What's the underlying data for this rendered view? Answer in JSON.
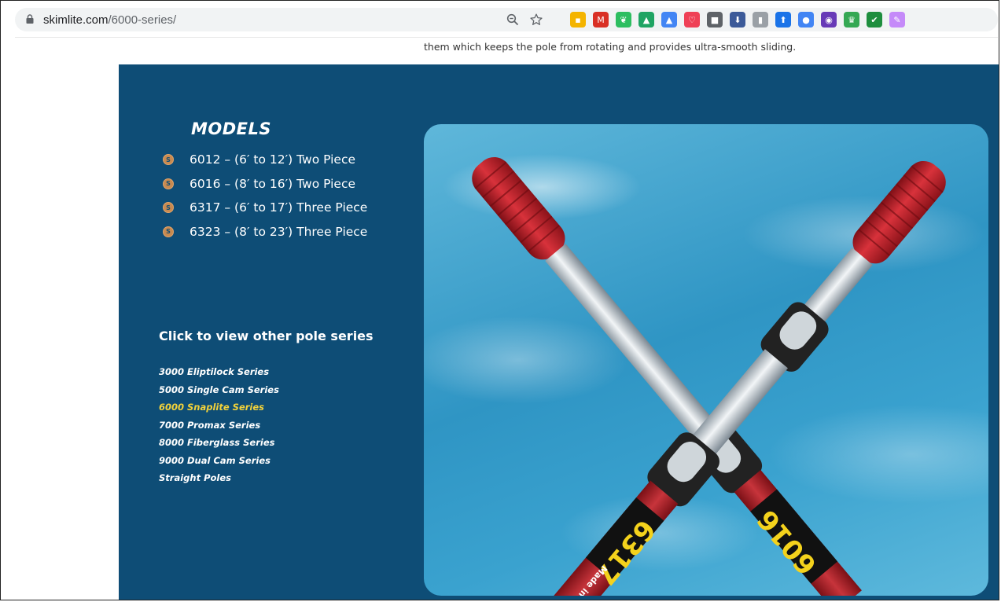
{
  "browser": {
    "url_domain": "skimlite.com",
    "url_path": "/6000-series/",
    "icons": [
      "zoom-icon",
      "bookmark-star-icon"
    ],
    "extensions": [
      {
        "name": "extension-yellow-icon",
        "color": "#f4b400",
        "glyph": "▪"
      },
      {
        "name": "gmail-icon",
        "color": "#d93025",
        "glyph": "M"
      },
      {
        "name": "evernote-icon",
        "color": "#2dbe60",
        "glyph": "❦"
      },
      {
        "name": "google-drive-icon",
        "color": "#1fa463",
        "glyph": "▲"
      },
      {
        "name": "google-drive-alt-icon",
        "color": "#4285f4",
        "glyph": "▲"
      },
      {
        "name": "pocket-icon",
        "color": "#ef4056",
        "glyph": "♡"
      },
      {
        "name": "extension-gray-icon",
        "color": "#5f6368",
        "glyph": "■"
      },
      {
        "name": "download-icon",
        "color": "#3c5a99",
        "glyph": "⬇"
      },
      {
        "name": "office-icon",
        "color": "#9aa0a6",
        "glyph": "▮"
      },
      {
        "name": "upload-icon",
        "color": "#1a73e8",
        "glyph": "⬆"
      },
      {
        "name": "extension-blue-icon",
        "color": "#4285f4",
        "glyph": "●"
      },
      {
        "name": "camera-icon",
        "color": "#673ab7",
        "glyph": "◉"
      },
      {
        "name": "extension-green-icon",
        "color": "#34a853",
        "glyph": "♛"
      },
      {
        "name": "check-icon",
        "color": "#1e8e3e",
        "glyph": "✔"
      },
      {
        "name": "extension-partial-icon",
        "color": "#c58af9",
        "glyph": "✎"
      }
    ]
  },
  "page": {
    "top_text": "them which keeps the pole from rotating and provides ultra-smooth sliding.",
    "models_heading": "MODELS",
    "models": [
      "6012 – (6′ to 12′) Two Piece",
      "6016 – (8′ to 16′) Two Piece",
      "6317 – (6′ to 17′) Three Piece",
      "6323 – (8′ to 23′) Three Piece"
    ],
    "series_heading": "Click to view other pole series",
    "series": [
      {
        "label": "3000 Eliptilock Series",
        "active": false
      },
      {
        "label": "5000 Single Cam Series",
        "active": false
      },
      {
        "label": "6000 Snaplite Series",
        "active": true
      },
      {
        "label": "7000 Promax Series",
        "active": false
      },
      {
        "label": "8000 Fiberglass Series",
        "active": false
      },
      {
        "label": "9000 Dual Cam Series",
        "active": false
      },
      {
        "label": "Straight Poles",
        "active": false
      }
    ],
    "photo": {
      "label_left": "6317",
      "label_right": "6016",
      "badge": "Made in USA"
    }
  },
  "colors": {
    "section_bg": "#0e4d76",
    "active_link": "#f2d23a",
    "bullet": "#c88a50",
    "grip_red": "#c5202a"
  }
}
